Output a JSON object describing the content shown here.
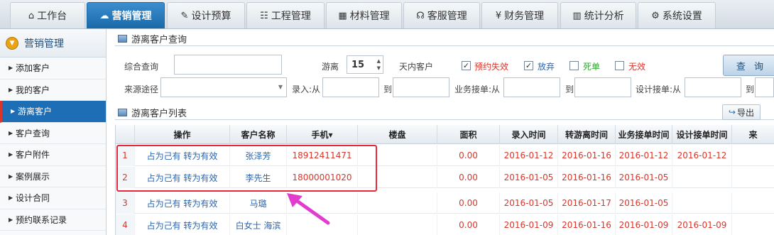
{
  "nav": {
    "tabs": [
      {
        "label": "工作台",
        "icon": "home-icon",
        "glyph": "⌂"
      },
      {
        "label": "营销管理",
        "icon": "chat-icon",
        "glyph": "☁"
      },
      {
        "label": "设计预算",
        "icon": "edit-icon",
        "glyph": "✎"
      },
      {
        "label": "工程管理",
        "icon": "users-icon",
        "glyph": "☷"
      },
      {
        "label": "材料管理",
        "icon": "grid-icon",
        "glyph": "▦"
      },
      {
        "label": "客服管理",
        "icon": "headset-icon",
        "glyph": "☊"
      },
      {
        "label": "财务管理",
        "icon": "yen-icon",
        "glyph": "¥"
      },
      {
        "label": "统计分析",
        "icon": "chart-icon",
        "glyph": "▥"
      },
      {
        "label": "系统设置",
        "icon": "gear-icon",
        "glyph": "⚙"
      }
    ],
    "active_tab": "营销管理"
  },
  "sidebar": {
    "title": "营销管理",
    "items": [
      {
        "label": "添加客户"
      },
      {
        "label": "我的客户"
      },
      {
        "label": "游离客户"
      },
      {
        "label": "客户查询"
      },
      {
        "label": "客户附件"
      },
      {
        "label": "案例展示"
      },
      {
        "label": "设计合同"
      },
      {
        "label": "预约联系记录"
      }
    ],
    "active_item": "游离客户"
  },
  "query_panel": {
    "title": "游离客户查询",
    "general_query_label": "综合查询",
    "general_query_value": "",
    "free_label": "游离",
    "free_days_value": "15",
    "days_label": "天内客户",
    "checkboxes": [
      {
        "label": "预约失效",
        "checked": true,
        "color": "#d9362b"
      },
      {
        "label": "放弃",
        "checked": true,
        "color": "#2a66b0"
      },
      {
        "label": "死单",
        "checked": false,
        "color": "#3aa33a"
      },
      {
        "label": "无效",
        "checked": false,
        "color": "#d9362b"
      }
    ],
    "query_button": "查 询",
    "source_label": "来源途径",
    "source_value": "",
    "entry_from_label": "录入:从",
    "to_label": "到",
    "business_from_label": "业务接单:从",
    "design_from_label": "设计接单:从"
  },
  "list_panel": {
    "title": "游离客户列表",
    "export_label": "导出",
    "columns": [
      "操作",
      "客户名称",
      "手机▾",
      "楼盘",
      "面积",
      "录入时间",
      "转游离时间",
      "业务接单时间",
      "设计接单时间",
      "来"
    ],
    "rows": [
      {
        "num": "1",
        "op": "占为己有 转为有效",
        "name": "张泽芳",
        "phone": "18912411471",
        "estate": "",
        "area": "0.00",
        "entry": "2016-01-12",
        "free": "2016-01-16",
        "biz": "2016-01-12",
        "design": "2016-01-12"
      },
      {
        "num": "2",
        "op": "占为己有 转为有效",
        "name": "李先生",
        "phone": "18000001020",
        "estate": "",
        "area": "0.00",
        "entry": "2016-01-05",
        "free": "2016-01-16",
        "biz": "2016-01-05",
        "design": ""
      },
      {
        "num": "3",
        "op": "占为己有 转为有效",
        "name": "马璐",
        "phone": "",
        "estate": "",
        "area": "0.00",
        "entry": "2016-01-05",
        "free": "2016-01-17",
        "biz": "2016-01-05",
        "design": ""
      },
      {
        "num": "4",
        "op": "占为己有 转为有效",
        "name": "白女士 海滨",
        "phone": "",
        "estate": "",
        "area": "0.00",
        "entry": "2016-01-09",
        "free": "2016-01-16",
        "biz": "2016-01-09",
        "design": "2016-01-09"
      }
    ]
  }
}
